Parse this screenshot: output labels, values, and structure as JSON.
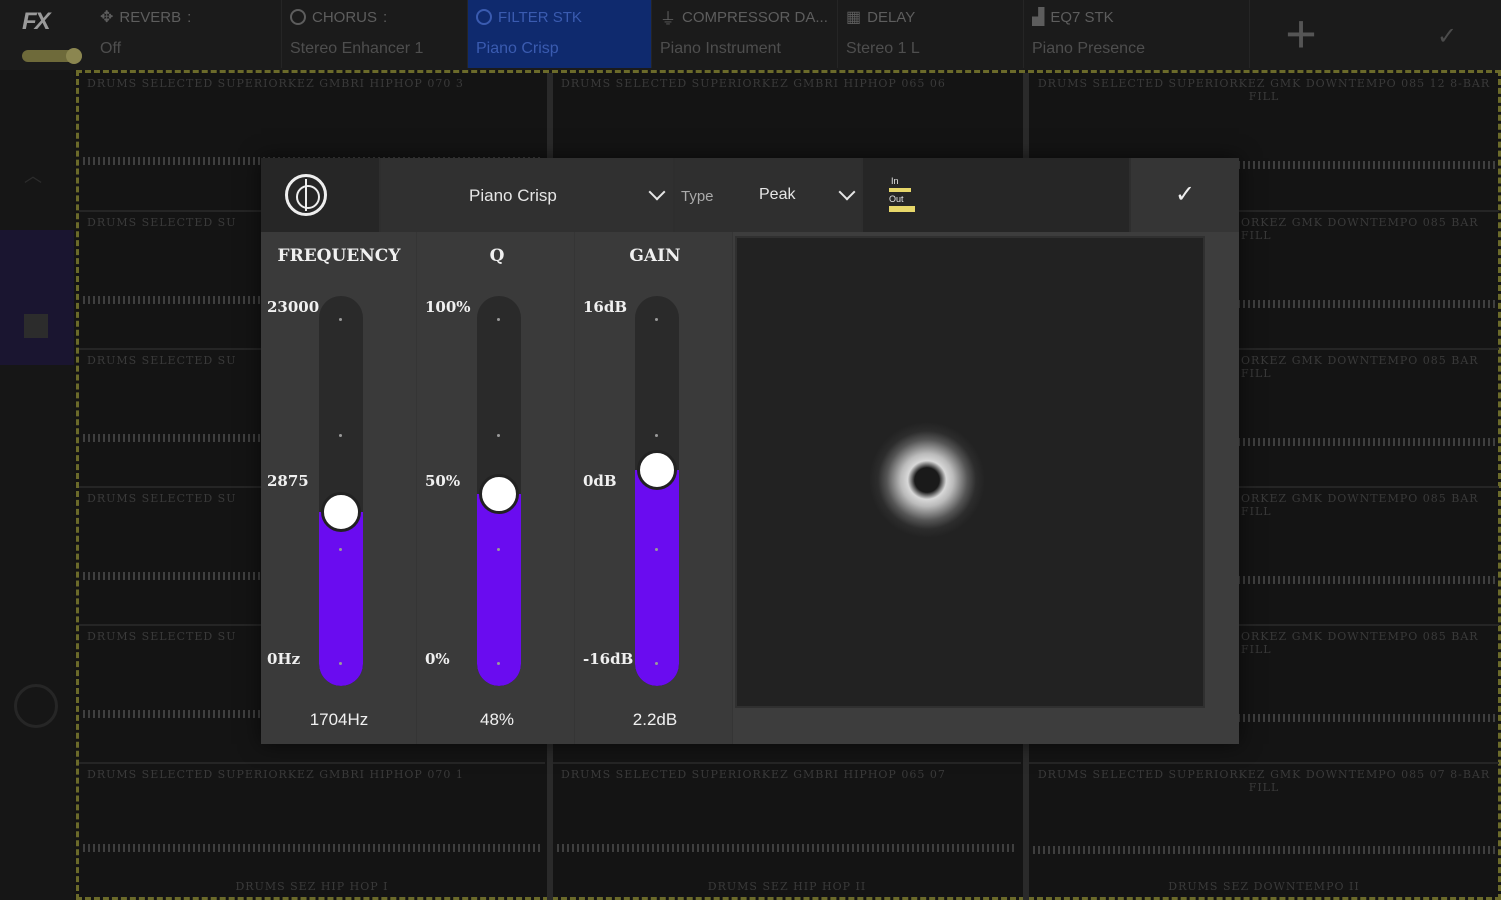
{
  "app": {
    "logo": "FX"
  },
  "fx_chain": [
    {
      "name": "REVERB",
      "preset": "Off",
      "icon": "plus-cross-icon",
      "active": false
    },
    {
      "name": "CHORUS",
      "preset": "Stereo Enhancer 1",
      "icon": "circle-plus-icon",
      "active": false
    },
    {
      "name": "FILTER STK",
      "preset": "Piano Crisp",
      "icon": "circle-arrow-icon",
      "active": true
    },
    {
      "name": "COMPRESSOR DA...",
      "preset": "Piano Instrument",
      "icon": "compressor-icon",
      "active": false
    },
    {
      "name": "DELAY",
      "preset": "Stereo 1 L",
      "icon": "grid-icon",
      "active": false
    },
    {
      "name": "EQ7 STK",
      "preset": "Piano Presence",
      "icon": "eq-bars-icon",
      "active": false
    }
  ],
  "tracks": {
    "columns": [
      {
        "top_label": "DRUMS SELECTED SUPERIORKEZ GMBRI HIPHOP 070 3",
        "row_label": "DRUMS SELECTED SU",
        "bottom_label": "DRUMS SELECTED SUPERIORKEZ GMBRI HIPHOP 070 1",
        "footer": "DRUMS SEZ HIP HOP I"
      },
      {
        "top_label": "DRUMS SELECTED SUPERIORKEZ GMBRI HIPHOP 065 06",
        "bottom_label": "DRUMS SELECTED SUPERIORKEZ GMBRI HIPHOP 065 07",
        "footer": "DRUMS SEZ HIP HOP II"
      },
      {
        "top_label": "DRUMS SELECTED SUPERIORKEZ GMK DOWNTEMPO 085 12 8-BAR FILL",
        "row_label": "ORKEZ GMK DOWNTEMPO 085 BAR FILL",
        "bottom_label": "DRUMS SELECTED SUPERIORKEZ GMK DOWNTEMPO 085 07 8-BAR FILL",
        "footer": "DRUMS SEZ DOWNTEMPO II"
      }
    ]
  },
  "dialog": {
    "preset": "Piano Crisp",
    "type_label": "Type",
    "type_value": "Peak",
    "io_in": "In",
    "io_out": "Out",
    "frequency": {
      "title": "FREQUENCY",
      "max": "23000",
      "mid": "2875",
      "min": "0Hz",
      "value": "1704Hz",
      "level": 0.44
    },
    "q": {
      "title": "Q",
      "max": "100%",
      "mid": "50%",
      "min": "0%",
      "value": "48%",
      "level": 0.49
    },
    "gain": {
      "title": "GAIN",
      "max": "16dB",
      "mid": "0dB",
      "min": "-16dB",
      "value": "2.2dB",
      "level": 0.56
    }
  },
  "colors": {
    "accent": "#6a0cf0",
    "active_slot": "#0f2a6e",
    "grid_border": "#6b6a2a",
    "io_bar": "#e7d76a"
  }
}
